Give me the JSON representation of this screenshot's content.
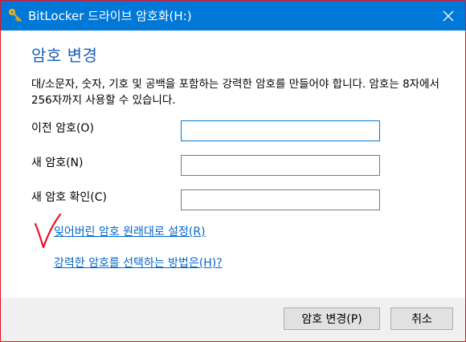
{
  "window": {
    "title": "BitLocker 드라이브 암호화(H:)",
    "title_color": "#0078d7",
    "icon": "bitlocker-key-icon"
  },
  "main": {
    "heading": "암호 변경",
    "description": "대/소문자, 숫자, 기호 및 공백을 포함하는 강력한 암호를 만들어야 합니다. 암호는 8자에서 256자까지 사용할 수 있습니다.",
    "fields": [
      {
        "label": "이전 암호(O)",
        "value": ""
      },
      {
        "label": "새 암호(N)",
        "value": ""
      },
      {
        "label": "새 암호 확인(C)",
        "value": ""
      }
    ],
    "links": {
      "reset": "잊어버린 암호 원래대로 설정(R)",
      "help": "강력한 암호를 선택하는 방법은(H)?"
    },
    "annotation": "red-checkmark"
  },
  "footer": {
    "change_button": "암호 변경(P)",
    "cancel_button": "취소"
  },
  "colors": {
    "accent": "#0078d7",
    "heading": "#1a5fb4",
    "link": "#0066cc",
    "annotation": "#e81123"
  }
}
